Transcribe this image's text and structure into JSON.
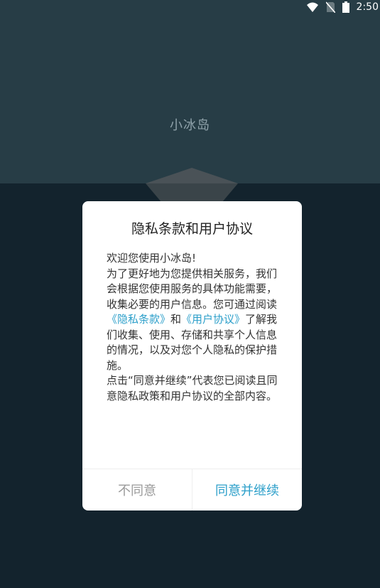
{
  "status_bar": {
    "time": "2:50",
    "icons": [
      "wifi-icon",
      "no-sim-icon",
      "battery-icon"
    ]
  },
  "app": {
    "title": "小冰岛"
  },
  "dialog": {
    "title": "隐私条款和用户协议",
    "body": {
      "greeting": "欢迎您使用小冰岛!",
      "para1_a": "为了更好地为您提供相关服务，我们会根据您使用服务的具体功能需要，收集必要的用户信息。您可通过阅读",
      "privacy_link": "《隐私条款》",
      "and_text": "和",
      "user_agreement_link": "《用户协议》",
      "para1_b": "了解我们收集、使用、存储和共享个人信息的情况，以及对您个人隐私的保护措施。",
      "para2": "点击“同意并继续”代表您已阅读且同意隐私政策和用户协议的全部内容。"
    },
    "disagree_label": "不同意",
    "agree_label": "同意并继续"
  },
  "colors": {
    "top_panel": "#273d46",
    "bottom_panel": "#13232d",
    "accent": "#2c9fca",
    "muted_button": "#9a9a9a"
  }
}
